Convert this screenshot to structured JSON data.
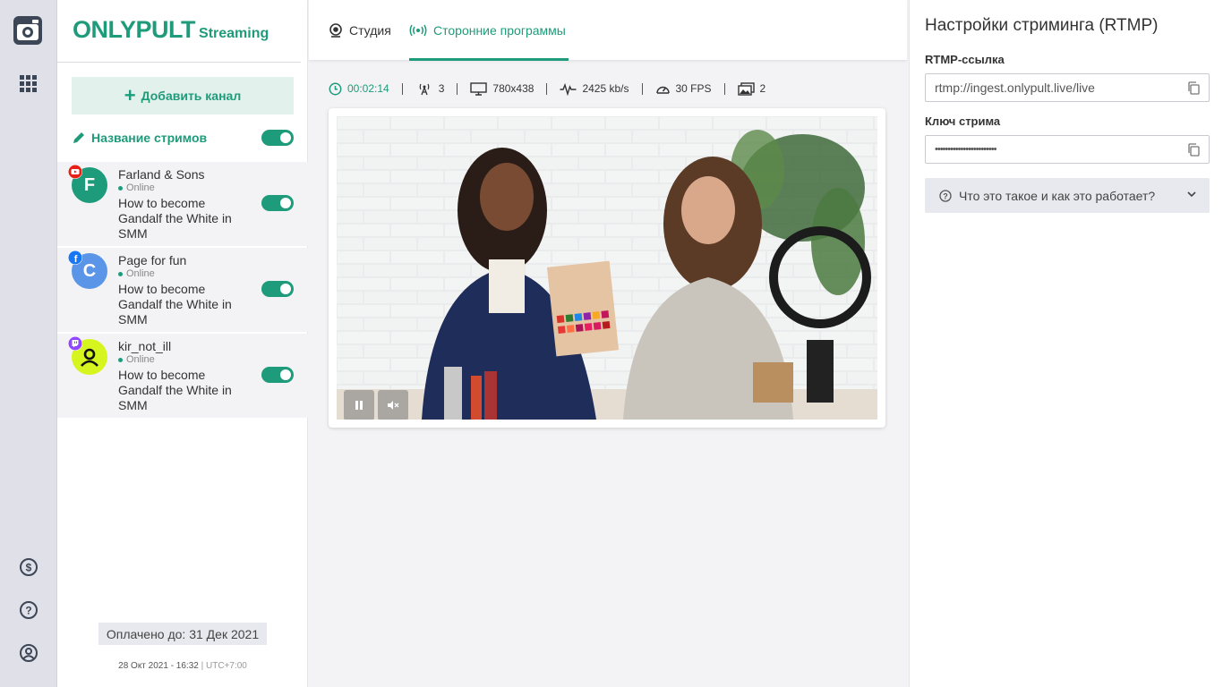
{
  "rail": {
    "icons": [
      "app-logo-icon",
      "apps-grid-icon",
      "billing-icon",
      "help-icon",
      "profile-icon"
    ]
  },
  "sidebar": {
    "brand_main": "ONLYPULT",
    "brand_sub": "Streaming",
    "add_channel_label": "Добавить канал",
    "stream_names_label": "Название стримов",
    "stream_names_enabled": true,
    "channels": [
      {
        "initial": "F",
        "name": "Farland & Sons",
        "status": "Online",
        "title": "How to become Gandalf the White in SMM",
        "platform": "youtube",
        "enabled": true,
        "avatar_color": "#1e9b7a"
      },
      {
        "initial": "C",
        "name": "Page for fun",
        "status": "Online",
        "title": "How to become Gandalf the White in SMM",
        "platform": "facebook",
        "enabled": true,
        "avatar_color": "#5b95e8"
      },
      {
        "initial": "",
        "name": "kir_not_ill",
        "status": "Online",
        "title": "How to become Gandalf the White in SMM",
        "platform": "twitch",
        "enabled": true,
        "avatar_color": "#d6f51e"
      }
    ],
    "paid_until": "Оплачено до: 31 Дек 2021",
    "datetime": "28 Окт 2021 - 16:32",
    "timezone": "UTC+7:00"
  },
  "main": {
    "tabs": [
      {
        "label": "Студия",
        "active": false
      },
      {
        "label": "Сторонние программы",
        "active": true
      }
    ],
    "stats": {
      "duration": "00:02:14",
      "viewers": "3",
      "resolution": "780x438",
      "bitrate": "2425 kb/s",
      "fps": "30 FPS",
      "sources": "2"
    }
  },
  "right": {
    "title": "Настройки стриминга (RTMP)",
    "rtmp_label": "RTMP-ссылка",
    "rtmp_value": "rtmp://ingest.onlypult.live/live",
    "key_label": "Ключ стрима",
    "key_value": "••••••••••••••••••••••••",
    "faq_label": "Что это такое и как это работает?"
  },
  "colors": {
    "accent": "#1e9b7a",
    "rail_bg": "#dfe0e8",
    "main_bg": "#f3f3f5"
  }
}
